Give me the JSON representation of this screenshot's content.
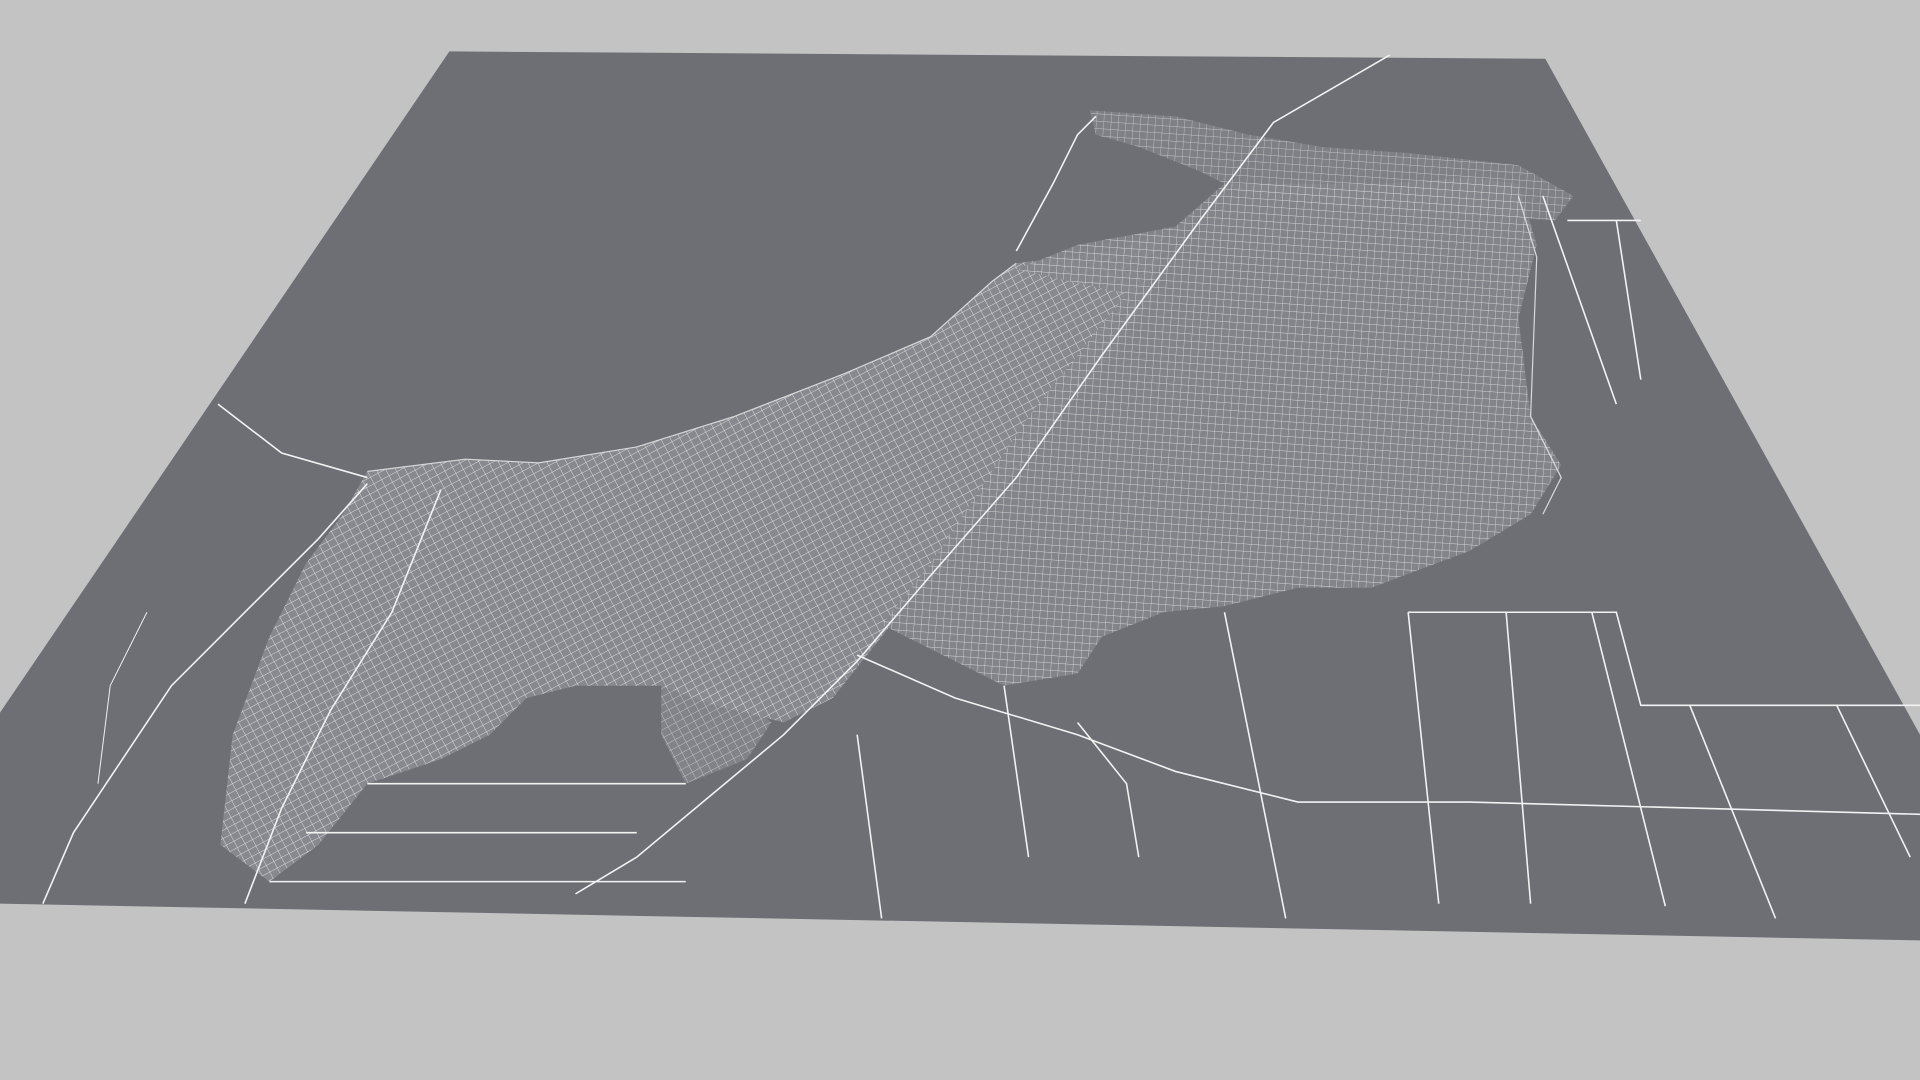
{
  "scene": {
    "background_color": "#c3c3c3",
    "plane_color": "#6d6f75",
    "road_color": "#f2f2f2"
  }
}
